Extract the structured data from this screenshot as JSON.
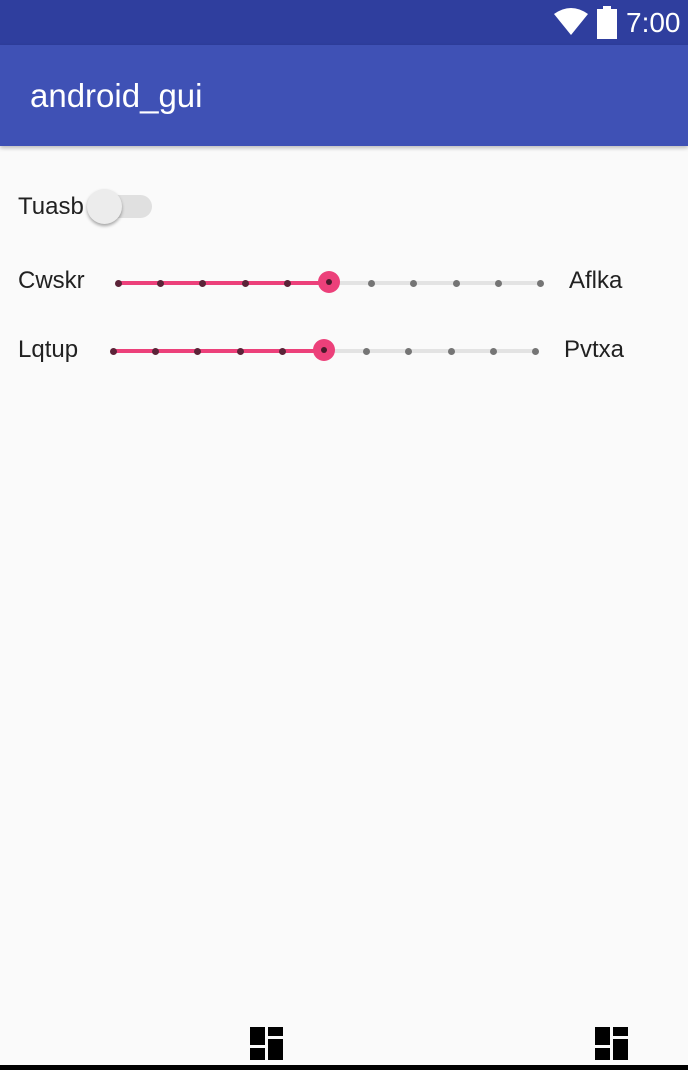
{
  "status_bar": {
    "time": "7:00",
    "icons": [
      "wifi-icon",
      "battery-icon"
    ]
  },
  "app_bar": {
    "title": "android_gui"
  },
  "switch_row": {
    "label": "Tuasb",
    "checked": false
  },
  "seekbars": [
    {
      "left_label": "Cwskr",
      "right_label": "Aflka",
      "max": 10,
      "value": 5
    },
    {
      "left_label": "Lqtup",
      "right_label": "Pvtxa",
      "max": 10,
      "value": 5
    }
  ],
  "nav_bar": {
    "icons": [
      "dashboard-icon",
      "dashboard-icon"
    ]
  },
  "colors": {
    "status_bar": "#2F3E9E",
    "app_bar": "#3F51B5",
    "accent": "#EC407A",
    "background": "#FAFAFA"
  }
}
